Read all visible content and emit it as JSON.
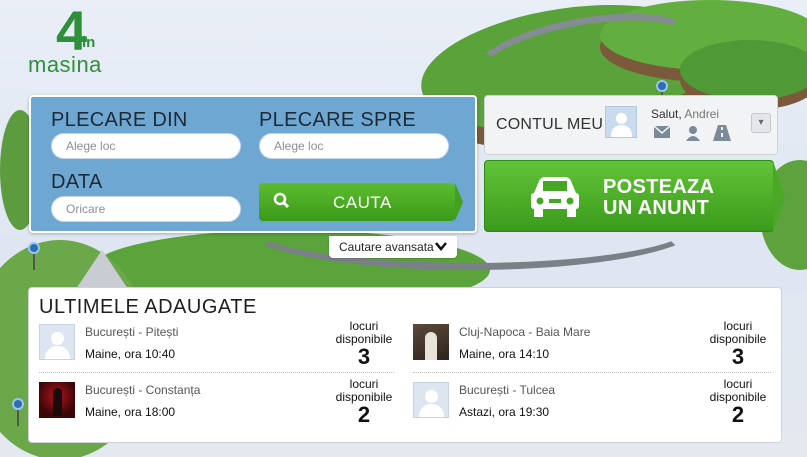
{
  "logo": {
    "four": "4",
    "in": "in",
    "text": "masina"
  },
  "search": {
    "from_label": "PLECARE DIN",
    "from_placeholder": "Alege loc",
    "to_label": "PLECARE SPRE",
    "to_placeholder": "Alege loc",
    "date_label": "DATA",
    "date_placeholder": "Oricare",
    "search_button": "CAUTA",
    "advanced": "Cautare avansata"
  },
  "account": {
    "title": "CONTUL MEU",
    "greeting": "Salut,",
    "user_name": "Andrei",
    "icons": [
      "mail-icon",
      "user-icon",
      "road-icon"
    ]
  },
  "post": {
    "line1": "POSTEAZA",
    "line2": "UN ANUNT"
  },
  "latest": {
    "title": "ULTIMELE ADAUGATE",
    "seats_label_1": "locuri",
    "seats_label_2": "disponibile",
    "rides": [
      {
        "route": "București - Pitești",
        "when": "Maine, ora 10:40",
        "seats": "3",
        "avatar": "blank"
      },
      {
        "route": "Cluj-Napoca - Baia Mare",
        "when": "Maine, ora 14:10",
        "seats": "3",
        "avatar": "photo1"
      },
      {
        "route": "București - Constanța",
        "when": "Maine, ora 18:00",
        "seats": "2",
        "avatar": "photo2"
      },
      {
        "route": "București - Tulcea",
        "when": "Astazi, ora 19:30",
        "seats": "2",
        "avatar": "blank"
      }
    ]
  },
  "colors": {
    "panel_blue": "#6fa7d3",
    "green": "#3a9c1c",
    "text_dark": "#1e2a36"
  }
}
